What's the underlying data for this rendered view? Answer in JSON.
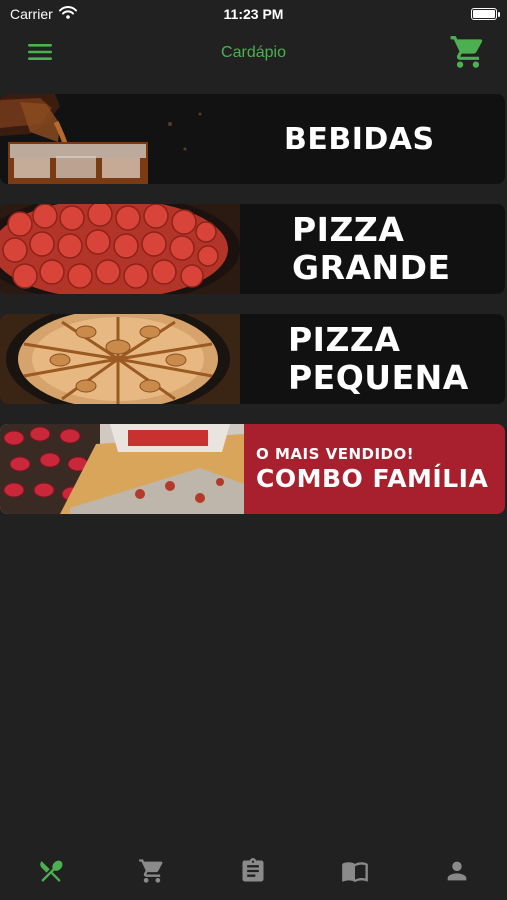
{
  "status": {
    "carrier": "Carrier",
    "time": "11:23 PM"
  },
  "header": {
    "title": "Cardápio"
  },
  "colors": {
    "accent": "#4caf50",
    "background": "#212121",
    "combo_red": "#a8202d"
  },
  "categories": [
    {
      "id": "bebidas",
      "lines": [
        "BEBIDAS"
      ],
      "image": "cola-glass-photo"
    },
    {
      "id": "pizza-grande",
      "lines": [
        "PIZZA",
        "GRANDE"
      ],
      "image": "pepperoni-pizza-photo"
    },
    {
      "id": "pizza-pequena",
      "lines": [
        "PIZZA",
        "PEQUENA"
      ],
      "image": "doce-de-leite-pizza-photo"
    },
    {
      "id": "combo-familia",
      "tagline": "O MAIS VENDIDO!",
      "title": "COMBO FAMÍLIA",
      "image": "pizza-box-photo"
    }
  ],
  "tabs": [
    {
      "id": "menu",
      "icon": "utensils-icon",
      "active": true
    },
    {
      "id": "cart",
      "icon": "cart-icon",
      "active": false
    },
    {
      "id": "orders",
      "icon": "clipboard-icon",
      "active": false
    },
    {
      "id": "catalog",
      "icon": "book-icon",
      "active": false
    },
    {
      "id": "profile",
      "icon": "person-icon",
      "active": false
    }
  ]
}
